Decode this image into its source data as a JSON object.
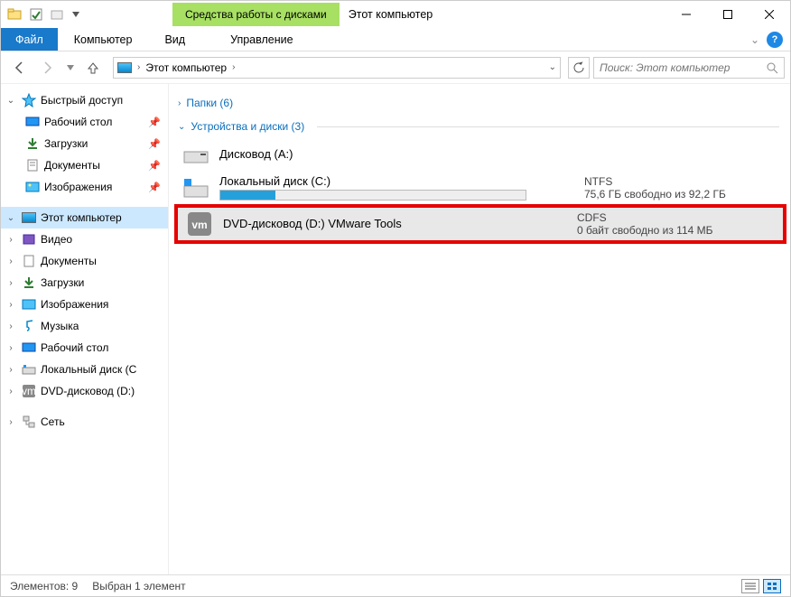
{
  "titlebar": {
    "context_tab": "Средства работы с дисками",
    "title": "Этот компьютер"
  },
  "menubar": {
    "file": "Файл",
    "computer": "Компьютер",
    "view": "Вид",
    "manage": "Управление"
  },
  "nav": {
    "breadcrumb": "Этот компьютер",
    "search_placeholder": "Поиск: Этот компьютер"
  },
  "sidebar": {
    "quick_access": "Быстрый доступ",
    "qa_items": [
      {
        "label": "Рабочий стол",
        "pinned": true
      },
      {
        "label": "Загрузки",
        "pinned": true
      },
      {
        "label": "Документы",
        "pinned": true
      },
      {
        "label": "Изображения",
        "pinned": true
      }
    ],
    "this_pc": "Этот компьютер",
    "pc_items": [
      {
        "label": "Видео"
      },
      {
        "label": "Документы"
      },
      {
        "label": "Загрузки"
      },
      {
        "label": "Изображения"
      },
      {
        "label": "Музыка"
      },
      {
        "label": "Рабочий стол"
      },
      {
        "label": "Локальный диск (C"
      },
      {
        "label": "DVD-дисковод (D:)"
      }
    ],
    "network": "Сеть"
  },
  "content": {
    "folders_group": "Папки (6)",
    "drives_group": "Устройства и диски (3)",
    "drives": [
      {
        "title": "Дисковод (A:)",
        "fs": "",
        "info": "",
        "barPct": 0
      },
      {
        "title": "Локальный диск (C:)",
        "fs": "NTFS",
        "info": "75,6 ГБ свободно из 92,2 ГБ",
        "barPct": 18
      },
      {
        "title": "DVD-дисковод (D:) VMware Tools",
        "fs": "CDFS",
        "info": "0 байт свободно из 114 МБ",
        "barPct": 0
      }
    ]
  },
  "statusbar": {
    "items": "Элементов: 9",
    "selected": "Выбран 1 элемент"
  }
}
